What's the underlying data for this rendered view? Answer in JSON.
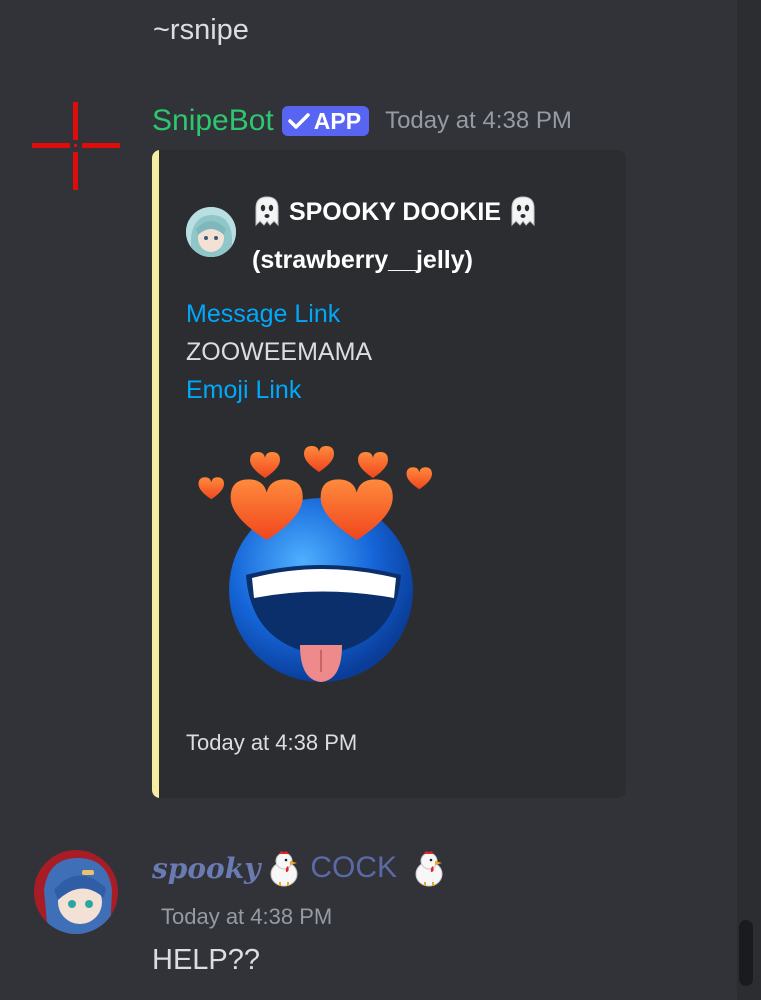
{
  "previous_message": {
    "text": "~rsnipe"
  },
  "bot_message": {
    "author": "SnipeBot",
    "badge": "APP",
    "timestamp": "Today at 4:38 PM",
    "embed": {
      "author_line1": "SPOOKY DOOKIE",
      "author_line2": "(strawberry__jelly)",
      "message_link": "Message Link",
      "content": "ZOOWEEMAMA",
      "emoji_link": "Emoji Link",
      "footer": "Today at 4:38 PM",
      "accent_color": "#f5eda0"
    }
  },
  "user_message": {
    "name_script": "spooky",
    "name_rest": "COCK",
    "timestamp": "Today at 4:38 PM",
    "text": "HELP??"
  },
  "icons": [
    "crosshair-avatar-icon",
    "verified-check-icon",
    "ghost-emoji-icon",
    "chicken-emoji-icon",
    "heart-eyes-emoji-icon"
  ],
  "colors": {
    "background": "#313338",
    "bot_name": "#2dc770",
    "badge": "#5865f2",
    "link": "#00a8fc",
    "user_name": "#5b6aa6"
  }
}
